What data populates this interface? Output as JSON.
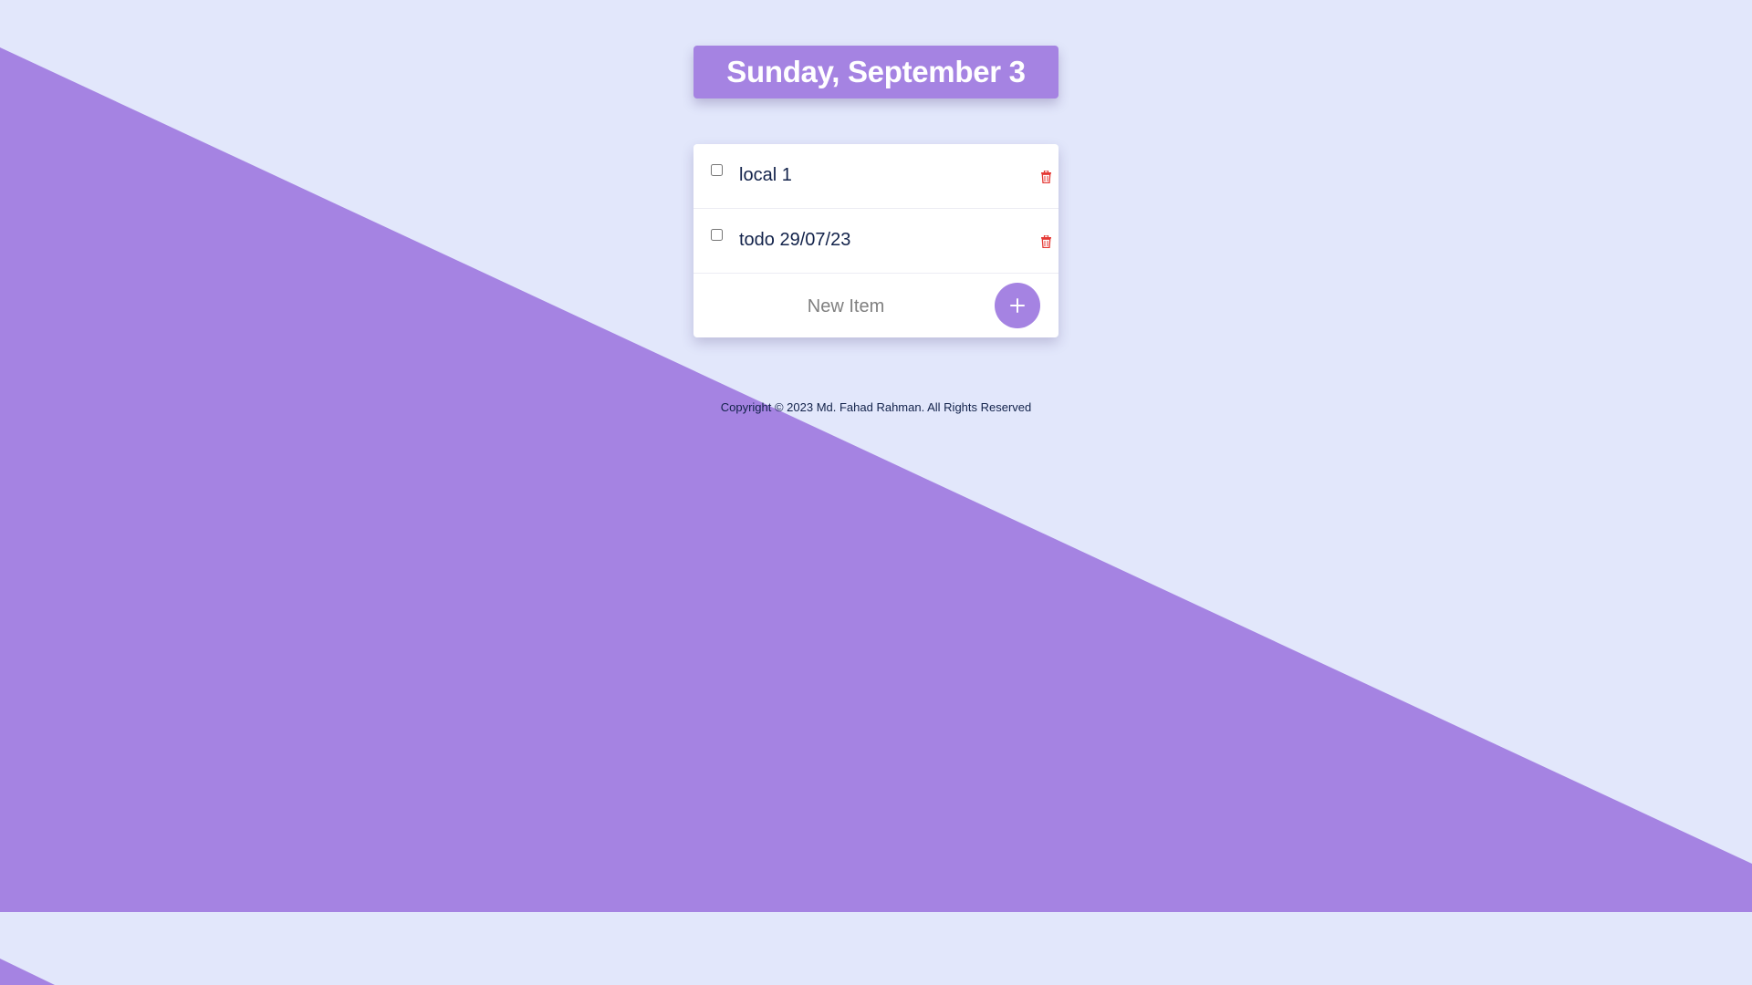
{
  "colors": {
    "accent": "#a583e2",
    "background": "#e2e7fb",
    "text": "#12224a",
    "delete": "#e53935"
  },
  "heading": {
    "date": "Sunday, September 3"
  },
  "todo_list": {
    "items": [
      {
        "text": "local 1",
        "checked": false,
        "delete_icon": "trash-icon"
      },
      {
        "text": "todo 29/07/23",
        "checked": false,
        "delete_icon": "trash-icon"
      }
    ],
    "new_item": {
      "placeholder": "New Item",
      "value": "",
      "add_label": "+"
    }
  },
  "footer": {
    "copyright": "Copyright © 2023 Md. Fahad Rahman. All Rights Reserved"
  }
}
